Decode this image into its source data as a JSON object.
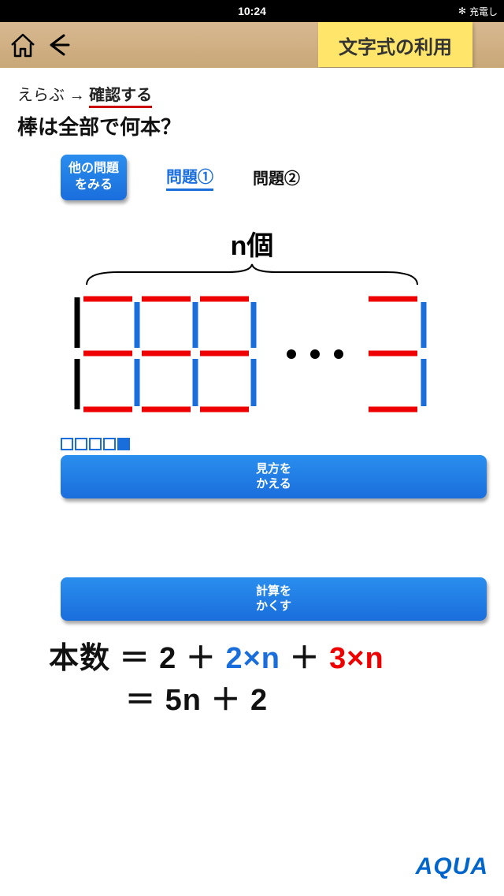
{
  "status": {
    "time": "10:24",
    "right": "充電し"
  },
  "toolbar": {
    "title": "文字式の利用"
  },
  "breadcrumb": {
    "step1": "えらぶ",
    "arrow": "→",
    "step2": "確認する"
  },
  "question": "棒は全部で何本？",
  "buttons": {
    "other_problems_l1": "他の問題",
    "other_problems_l2": "をみる",
    "change_view_l1": "見方を",
    "change_view_l2": "かえる",
    "hide_calc_l1": "計算を",
    "hide_calc_l2": "かくす"
  },
  "tabs": {
    "tab1": "問題①",
    "tab2": "問題②"
  },
  "diagram": {
    "n_label": "n個",
    "ellipsis": "・・・"
  },
  "formula": {
    "label": "本数",
    "eq": "＝",
    "c1": "2",
    "plus": "＋",
    "c2": "2×n",
    "c3": "3×n",
    "simplified": "5n ＋ 2"
  },
  "brand": "AQUA"
}
